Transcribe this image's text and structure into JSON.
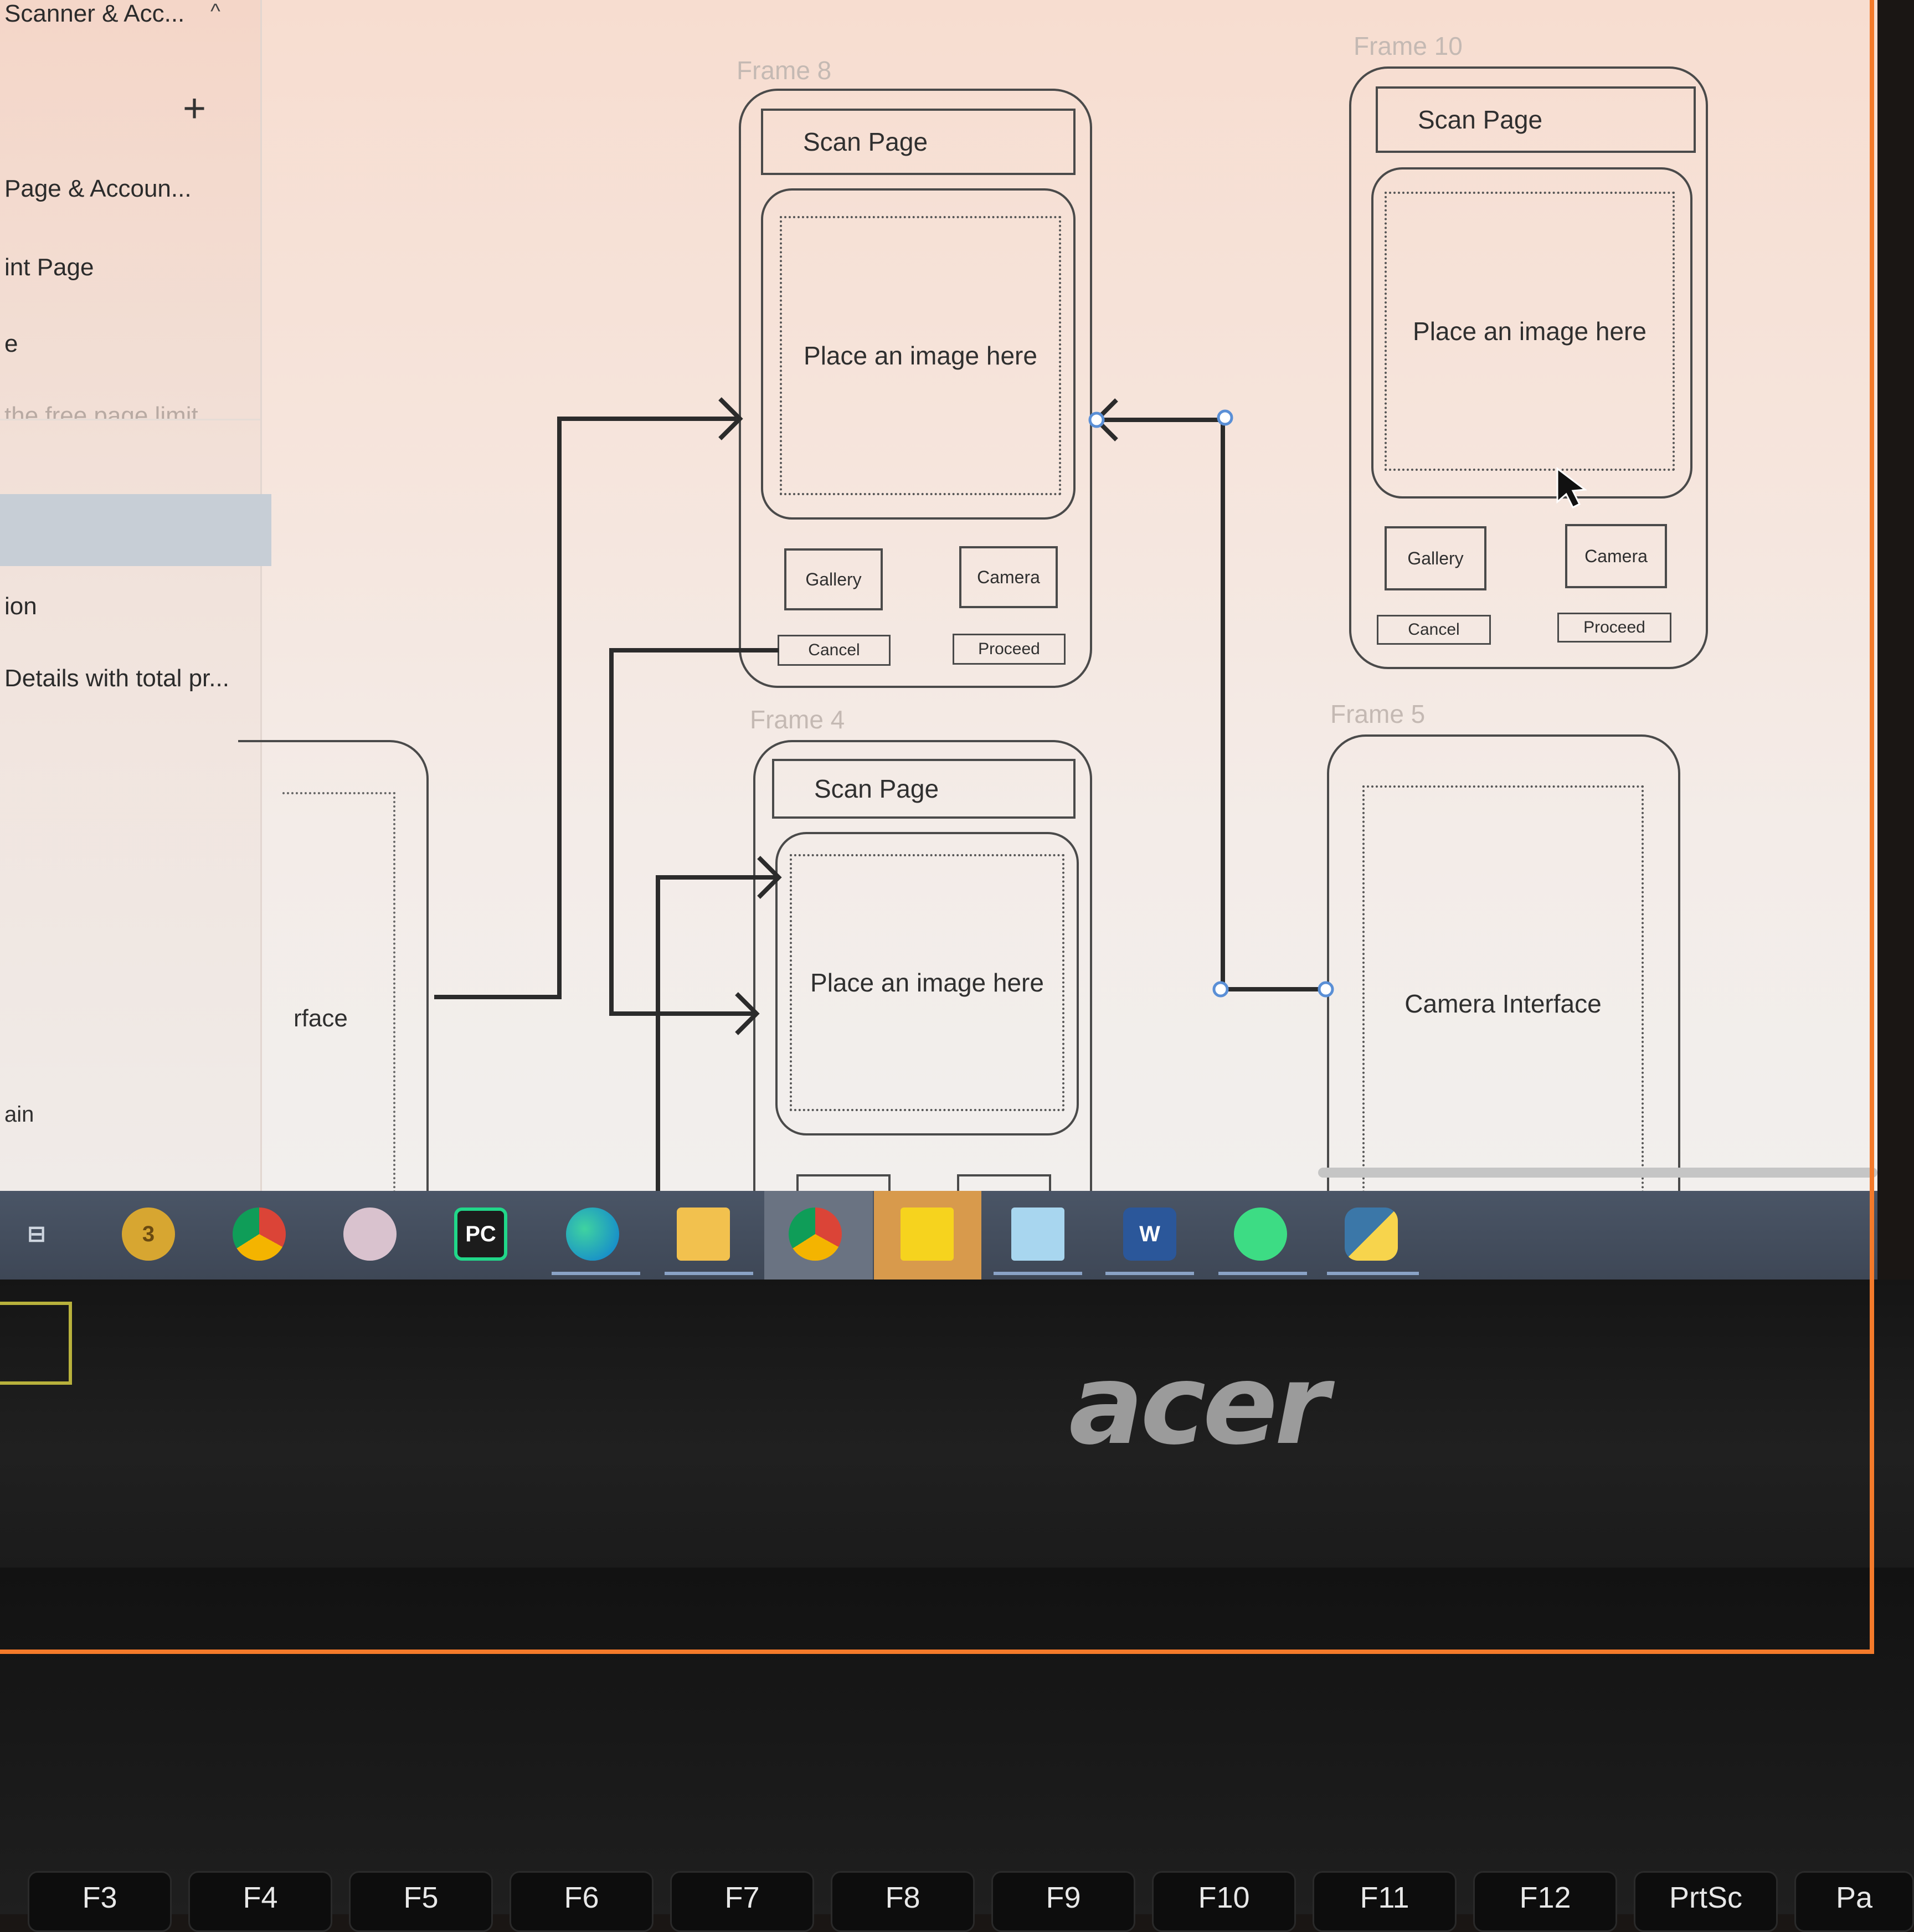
{
  "sidebar": {
    "header_label": "Scanner & Acc...",
    "collapse_glyph": "^",
    "add_glyph": "+",
    "items": [
      {
        "label": "Page & Accoun..."
      },
      {
        "label": "int Page"
      },
      {
        "label": "e"
      },
      {
        "label": "the free page limit"
      },
      {
        "label": "ion"
      },
      {
        "label": "Details with total pr..."
      }
    ]
  },
  "canvas": {
    "frames": [
      {
        "label": "Frame 8",
        "title": "Scan Page",
        "image_text": "Place an image here",
        "btn_gallery": "Gallery",
        "btn_camera": "Camera",
        "btn_cancel": "Cancel",
        "btn_proceed": "Proceed"
      },
      {
        "label": "Frame 10",
        "title": "Scan Page",
        "image_text": "Place an image here",
        "btn_gallery": "Gallery",
        "btn_camera": "Camera",
        "btn_cancel": "Cancel",
        "btn_proceed": "Proceed"
      },
      {
        "label": "Frame 4",
        "title": "Scan Page",
        "image_text": "Place an image here"
      },
      {
        "label": "Frame 5",
        "body_text": "Camera Interface"
      }
    ],
    "partial_frame_texts": {
      "interface": "rface",
      "again": "ain"
    }
  },
  "taskbar": {
    "icons": [
      {
        "name": "task-view-icon",
        "label": "⊟"
      },
      {
        "name": "app-badge-icon",
        "label": "3"
      },
      {
        "name": "chrome-icon",
        "label": ""
      },
      {
        "name": "paint-3d-icon",
        "label": ""
      },
      {
        "name": "pycharm-icon",
        "label": "PC"
      },
      {
        "name": "edge-icon",
        "label": ""
      },
      {
        "name": "file-explorer-icon",
        "label": ""
      },
      {
        "name": "chrome-profile-icon",
        "label": ""
      },
      {
        "name": "sticky-notes-icon",
        "label": ""
      },
      {
        "name": "notepad-icon",
        "label": ""
      },
      {
        "name": "word-icon",
        "label": "W"
      },
      {
        "name": "android-studio-icon",
        "label": ""
      },
      {
        "name": "python-launcher-icon",
        "label": ""
      }
    ]
  },
  "laptop": {
    "brand": "acer",
    "keys": [
      "F3",
      "F4",
      "F5",
      "F6",
      "F7",
      "F8",
      "F9",
      "F10",
      "F11",
      "F12",
      "PrtSc",
      "Pa"
    ]
  },
  "colors": {
    "accent_outline": "#f47a2a",
    "taskbar": "#434d5c",
    "sidebar_selected": "#c7ced6"
  }
}
